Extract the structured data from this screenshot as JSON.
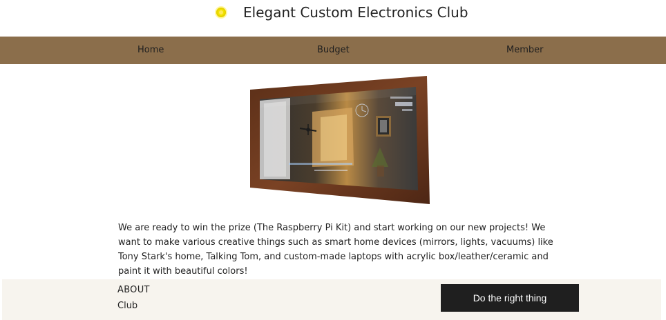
{
  "header": {
    "logo_icon": "circuit-chip-icon",
    "title": "Elegant Custom Electronics Club"
  },
  "nav": {
    "items": [
      {
        "label": "Home"
      },
      {
        "label": "Budget"
      },
      {
        "label": "Member"
      }
    ],
    "background_color": "#8b6e4b"
  },
  "main": {
    "image": {
      "subject": "smart-mirror-photo"
    },
    "paragraph": "We are ready to win the prize (The Raspberry Pi Kit) and start working on our new projects! We want to make various creative things such as smart home devices (mirrors, lights, vacuums) like Tony Stark's home, Talking Tom, and custom-made laptops with acrylic box/leather/ceramic and paint it with beautiful colors!"
  },
  "footer": {
    "title": "ABOUT",
    "subtitle": "Club",
    "cta_label": "Do the right thing",
    "background_color": "#f7f4ee",
    "cta_color": "#1f1f1f"
  }
}
